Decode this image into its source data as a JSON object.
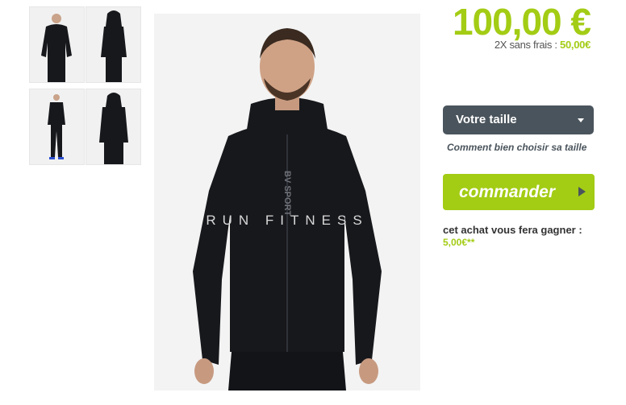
{
  "product": {
    "price": "100,00 €",
    "installments_label": "2X sans frais :",
    "installments_amount": "50,00€",
    "watermark": "RUN     FITNESS",
    "chest_logo": "BV SPORT"
  },
  "size": {
    "select_label": "Votre taille",
    "guide_link": "Comment bien choisir sa taille"
  },
  "order": {
    "button_label": "commander"
  },
  "reward": {
    "label": "cet achat vous fera gagner :",
    "value": "5,00€**"
  },
  "colors": {
    "accent": "#a3cc14",
    "button_dark": "#4a545c",
    "garment": "#17181c"
  },
  "thumbnails": [
    "front-view",
    "back-hood-view",
    "full-body-view",
    "back-view"
  ]
}
